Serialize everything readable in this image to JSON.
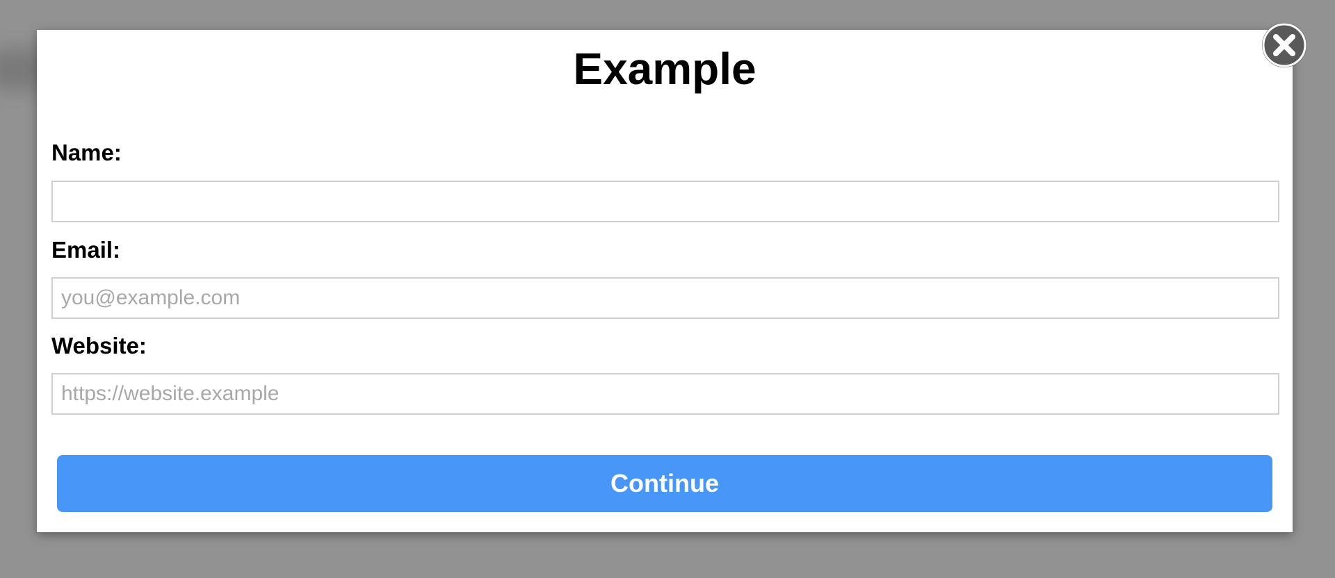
{
  "dialog": {
    "title": "Example",
    "fields": [
      {
        "label": "Name:",
        "value": "",
        "placeholder": ""
      },
      {
        "label": "Email:",
        "value": "",
        "placeholder": "you@example.com"
      },
      {
        "label": "Website:",
        "value": "",
        "placeholder": "https://website.example"
      }
    ],
    "submit_label": "Continue",
    "close_icon": "close-icon"
  },
  "colors": {
    "overlay": "#929292",
    "dialog_background": "#ffffff",
    "primary_button": "#4897f8",
    "close_button": "#595959",
    "input_border": "#cfcfcf",
    "placeholder": "#a8a8a8"
  }
}
